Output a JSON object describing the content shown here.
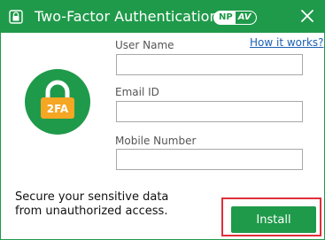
{
  "window": {
    "title": "Two-Factor Authentication",
    "brand": {
      "np": "NP",
      "av": "AV"
    }
  },
  "links": {
    "help": "How it works?"
  },
  "form": {
    "user_name_label": "User Name",
    "user_name_value": "",
    "email_label": "Email ID",
    "email_value": "",
    "mobile_label": "Mobile Number",
    "mobile_value": ""
  },
  "badge": {
    "text": "2FA"
  },
  "footer": {
    "tagline_line1": "Secure your sensitive data",
    "tagline_line2": "from unauthorized access.",
    "install_label": "Install"
  },
  "colors": {
    "brand_green": "#1f9a4a",
    "highlight_red": "#e0303a",
    "link_blue": "#1a5fb4"
  },
  "icons": [
    "app-lock-icon",
    "close-icon",
    "lock-2fa-icon"
  ]
}
